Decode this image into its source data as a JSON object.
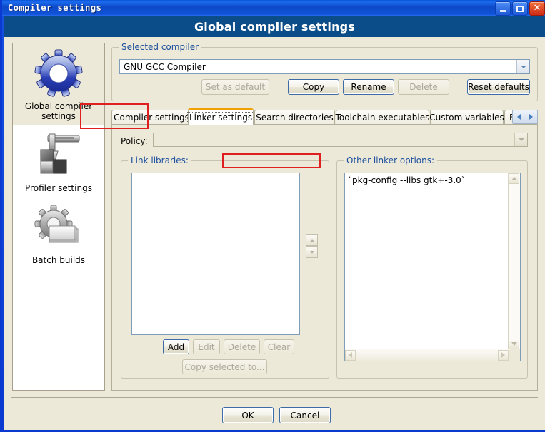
{
  "window": {
    "title": "Compiler settings",
    "buttons": {
      "minimize": "minimize-button",
      "maximize": "maximize-button",
      "close": "close-button",
      "close_glyph": "✕"
    }
  },
  "banner": {
    "title": "Global compiler settings"
  },
  "sidebar": {
    "items": [
      {
        "label": "Global compiler settings",
        "icon": "blue-gear-icon",
        "selected": true
      },
      {
        "label": "Profiler settings",
        "icon": "caliper-icon",
        "selected": false
      },
      {
        "label": "Batch builds",
        "icon": "gear-documents-icon",
        "selected": false
      }
    ]
  },
  "compiler_group": {
    "label": "Selected compiler",
    "combo_value": "GNU GCC Compiler",
    "buttons": [
      {
        "label": "Set as default",
        "enabled": false
      },
      {
        "label": "Copy",
        "enabled": true
      },
      {
        "label": "Rename",
        "enabled": true
      },
      {
        "label": "Delete",
        "enabled": false
      },
      {
        "label": "Reset defaults",
        "enabled": true
      }
    ]
  },
  "tabs": {
    "items": [
      {
        "label": "Compiler settings",
        "active": false
      },
      {
        "label": "Linker settings",
        "active": true
      },
      {
        "label": "Search directories",
        "active": false
      },
      {
        "label": "Toolchain executables",
        "active": false
      },
      {
        "label": "Custom variables",
        "active": false
      },
      {
        "label": "Bui",
        "active": false
      }
    ],
    "scroll_left": "◀",
    "scroll_right": "▶"
  },
  "linker_page": {
    "policy_label": "Policy:",
    "policy_value": "",
    "link_libraries": {
      "label": "Link libraries:",
      "items": [],
      "buttons": [
        {
          "label": "Add",
          "enabled": true
        },
        {
          "label": "Edit",
          "enabled": false
        },
        {
          "label": "Delete",
          "enabled": false
        },
        {
          "label": "Clear",
          "enabled": false
        }
      ],
      "copy_button": {
        "label": "Copy selected to...",
        "enabled": false
      }
    },
    "other_linker_options": {
      "label": "Other linker options:",
      "text": "`pkg-config --libs gtk+-3.0`"
    }
  },
  "dialog_buttons": [
    {
      "label": "OK",
      "default": true
    },
    {
      "label": "Cancel",
      "default": false
    }
  ],
  "annotations": {
    "colors": {
      "highlight": "#e02020",
      "active_tab_top": "#f0a000"
    },
    "boxes": [
      {
        "target": "tab-linker-settings"
      },
      {
        "target": "other-linker-options-label"
      }
    ]
  }
}
